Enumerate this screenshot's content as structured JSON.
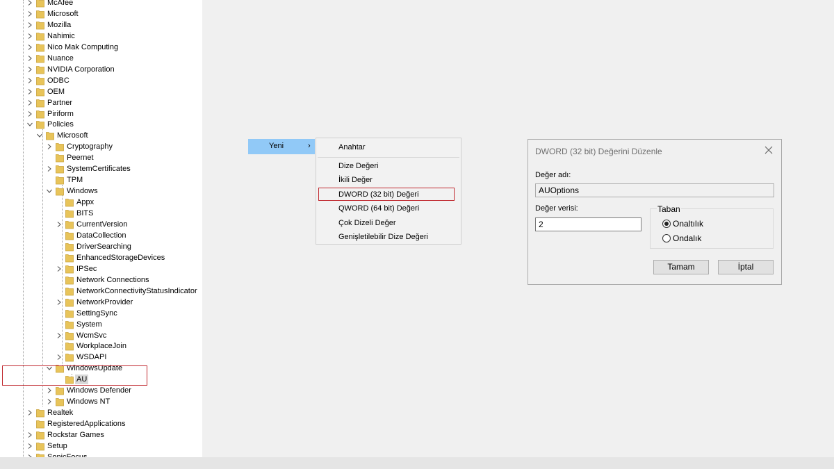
{
  "registry_tree": {
    "items": [
      {
        "label": "McAfee",
        "level": 0,
        "expanded": false
      },
      {
        "label": "Microsoft",
        "level": 0,
        "expanded": false
      },
      {
        "label": "Mozilla",
        "level": 0,
        "expanded": false
      },
      {
        "label": "Nahimic",
        "level": 0,
        "expanded": false
      },
      {
        "label": "Nico Mak Computing",
        "level": 0,
        "expanded": false
      },
      {
        "label": "Nuance",
        "level": 0,
        "expanded": false
      },
      {
        "label": "NVIDIA Corporation",
        "level": 0,
        "expanded": false
      },
      {
        "label": "ODBC",
        "level": 0,
        "expanded": false
      },
      {
        "label": "OEM",
        "level": 0,
        "expanded": false
      },
      {
        "label": "Partner",
        "level": 0,
        "expanded": false
      },
      {
        "label": "Piriform",
        "level": 0,
        "expanded": false
      },
      {
        "label": "Policies",
        "level": 0,
        "expanded": true
      },
      {
        "label": "Microsoft",
        "level": 1,
        "expanded": true
      },
      {
        "label": "Cryptography",
        "level": 2,
        "expanded": false
      },
      {
        "label": "Peernet",
        "level": 2,
        "leaf": true
      },
      {
        "label": "SystemCertificates",
        "level": 2,
        "expanded": false
      },
      {
        "label": "TPM",
        "level": 2,
        "leaf": true
      },
      {
        "label": "Windows",
        "level": 2,
        "expanded": true
      },
      {
        "label": "Appx",
        "level": 3,
        "leaf": true
      },
      {
        "label": "BITS",
        "level": 3,
        "leaf": true
      },
      {
        "label": "CurrentVersion",
        "level": 3,
        "expanded": false
      },
      {
        "label": "DataCollection",
        "level": 3,
        "leaf": true
      },
      {
        "label": "DriverSearching",
        "level": 3,
        "leaf": true
      },
      {
        "label": "EnhancedStorageDevices",
        "level": 3,
        "leaf": true
      },
      {
        "label": "IPSec",
        "level": 3,
        "expanded": false
      },
      {
        "label": "Network Connections",
        "level": 3,
        "leaf": true
      },
      {
        "label": "NetworkConnectivityStatusIndicator",
        "level": 3,
        "leaf": true
      },
      {
        "label": "NetworkProvider",
        "level": 3,
        "expanded": false
      },
      {
        "label": "SettingSync",
        "level": 3,
        "leaf": true
      },
      {
        "label": "System",
        "level": 3,
        "leaf": true
      },
      {
        "label": "WcmSvc",
        "level": 3,
        "expanded": false
      },
      {
        "label": "WorkplaceJoin",
        "level": 3,
        "leaf": true
      },
      {
        "label": "WSDAPI",
        "level": 3,
        "expanded": false
      },
      {
        "label": "WindowsUpdate",
        "level": 2,
        "expanded": true
      },
      {
        "label": "AU",
        "level": 3,
        "leaf": true,
        "selected": true
      },
      {
        "label": "Windows Defender",
        "level": 2,
        "expanded": false
      },
      {
        "label": "Windows NT",
        "level": 2,
        "expanded": false
      },
      {
        "label": "Realtek",
        "level": 0,
        "expanded": false
      },
      {
        "label": "RegisteredApplications",
        "level": 0,
        "leaf": true
      },
      {
        "label": "Rockstar Games",
        "level": 0,
        "expanded": false
      },
      {
        "label": "Setup",
        "level": 0,
        "expanded": false
      },
      {
        "label": "SonicFocus",
        "level": 0,
        "expanded": false
      }
    ]
  },
  "context_menu": {
    "new_label": "Yeni",
    "new_arrow": "›",
    "submenu": {
      "key_label": "Anahtar",
      "string_value": "Dize Değeri",
      "binary_value": "İkili Değer",
      "dword_value": "DWORD (32 bit) Değeri",
      "qword_value": "QWORD (64 bit) Değeri",
      "multi_string_value": "Çok Dizeli Değer",
      "expandable_string_value": "Genişletilebilir Dize Değeri"
    }
  },
  "dialog": {
    "title": "DWORD (32 bit) Değerini Düzenle",
    "value_name_label": "Değer adı:",
    "value_name": "AUOptions",
    "value_data_label": "Değer verisi:",
    "value_data": "2",
    "base_label": "Taban",
    "hex_label": "Onaltılık",
    "decimal_label": "Ondalık",
    "selected_base": "hex",
    "ok_label": "Tamam",
    "cancel_label": "İptal"
  },
  "colors": {
    "menu_highlight": "#91c9f7",
    "highlight_box": "#c0272d",
    "folder": "#e8c45a"
  },
  "icons": {
    "folder": "folder-icon",
    "expand": "chevron-right-icon",
    "collapse": "chevron-down-icon",
    "close": "close-icon"
  }
}
